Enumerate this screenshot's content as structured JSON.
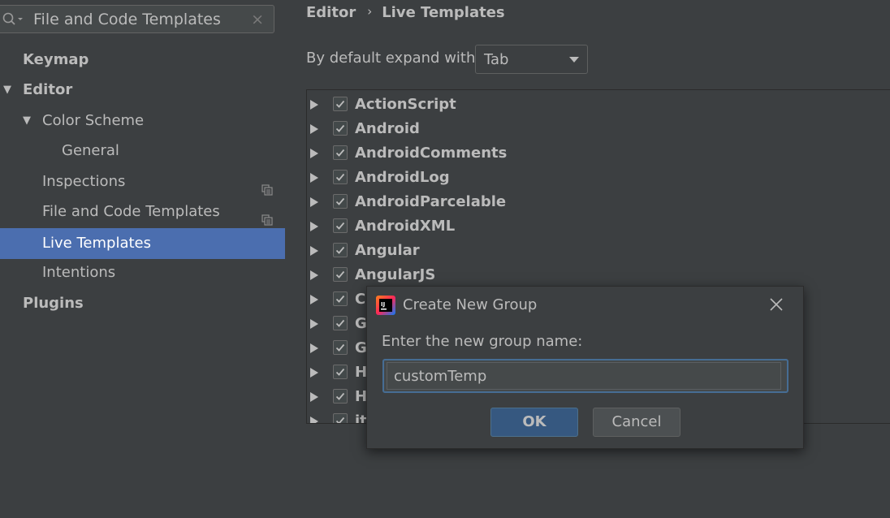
{
  "search": {
    "value": "File and Code Templates",
    "placeholder": "",
    "clear_glyph": "×"
  },
  "sidebar": {
    "items": [
      {
        "label": "Keymap"
      },
      {
        "label": "Editor"
      },
      {
        "label": "Color Scheme"
      },
      {
        "label": "General"
      },
      {
        "label": "Inspections"
      },
      {
        "label": "File and Code Templates"
      },
      {
        "label": "Live Templates"
      },
      {
        "label": "Intentions"
      },
      {
        "label": "Plugins"
      }
    ]
  },
  "breadcrumb": {
    "parent": "Editor",
    "separator": "›",
    "current": "Live Templates"
  },
  "expand": {
    "label": "By default expand with",
    "selected": "Tab"
  },
  "template_groups": [
    {
      "name": "ActionScript",
      "checked": true
    },
    {
      "name": "Android",
      "checked": true
    },
    {
      "name": "AndroidComments",
      "checked": true
    },
    {
      "name": "AndroidLog",
      "checked": true
    },
    {
      "name": "AndroidParcelable",
      "checked": true
    },
    {
      "name": "AndroidXML",
      "checked": true
    },
    {
      "name": "Angular",
      "checked": true
    },
    {
      "name": "AngularJS",
      "checked": true
    },
    {
      "name": "C",
      "checked": true
    },
    {
      "name": "G",
      "checked": true
    },
    {
      "name": "G",
      "checked": true
    },
    {
      "name": "H",
      "checked": true
    },
    {
      "name": "H",
      "checked": true
    },
    {
      "name": "it",
      "checked": true
    }
  ],
  "dialog": {
    "title": "Create New Group",
    "prompt": "Enter the new group name:",
    "value": "customTemp",
    "ok_label": "OK",
    "cancel_label": "Cancel",
    "logo_text": "IJ"
  },
  "icons": {
    "search": "search-icon",
    "clear": "close-icon",
    "expand": "triangle-right-icon",
    "collapse": "triangle-down-icon",
    "project_scope": "copy-settings-icon",
    "checkbox": "checkmark-icon",
    "dialog_logo": "intellij-logo-icon",
    "dialog_close": "close-icon"
  },
  "colors": {
    "background": "#3c3f41",
    "selection": "#4b6eaf",
    "focus_ring": "#466d94",
    "default_button": "#365880",
    "text": "#bbbbbb"
  }
}
